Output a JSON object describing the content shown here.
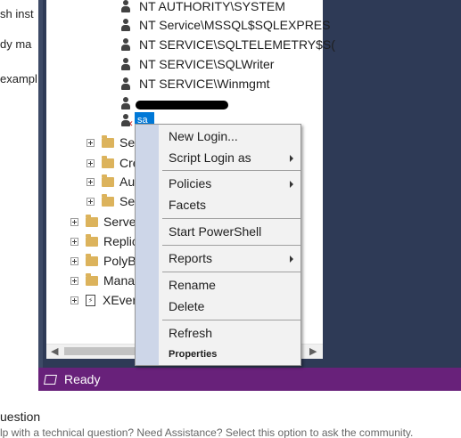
{
  "background_page": {
    "left_fragments": [
      "sh inst",
      "dy ma",
      "exampl"
    ],
    "question_heading": "uestion",
    "question_subtext": "lp with a technical question? Need Assistance? Select this option to ask the community."
  },
  "object_explorer": {
    "logins": [
      "NT AUTHORITY\\SYSTEM",
      "NT Service\\MSSQL$SQLEXPRES",
      "NT SERVICE\\SQLTELEMETRY$S(",
      "NT SERVICE\\SQLWriter",
      "NT SERVICE\\Winmgmt"
    ],
    "selected_login_label": "sa",
    "sub_folders": [
      "Ser",
      "Cre",
      "Au",
      "Ser"
    ],
    "top_folders": [
      "Serve",
      "Replic",
      "PolyB",
      "Mana"
    ],
    "xevents_label": "XEver"
  },
  "context_menu": {
    "items": [
      {
        "label": "New Login...",
        "submenu": false
      },
      {
        "label": "Script Login as",
        "submenu": true
      },
      {
        "label": "Policies",
        "submenu": true
      },
      {
        "label": "Facets",
        "submenu": false
      },
      {
        "label": "Start PowerShell",
        "submenu": false
      },
      {
        "label": "Reports",
        "submenu": true
      },
      {
        "label": "Rename",
        "submenu": false
      },
      {
        "label": "Delete",
        "submenu": false
      },
      {
        "label": "Refresh",
        "submenu": false
      },
      {
        "label": "Properties",
        "submenu": false
      }
    ]
  },
  "status_bar": {
    "text": "Ready",
    "color": "#68217a"
  },
  "colors": {
    "frame": "#2e3a56",
    "selection": "#0078d7",
    "menu_gutter": "#cdd6e8"
  }
}
